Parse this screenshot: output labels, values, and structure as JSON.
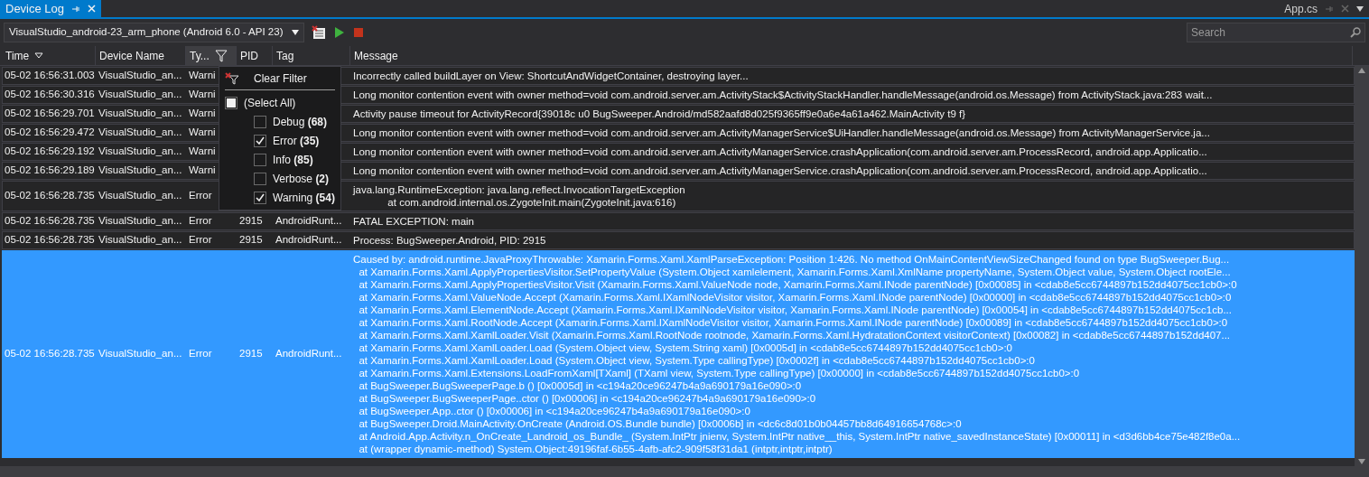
{
  "tabs": [
    {
      "label": "Device Log",
      "selected": true
    },
    {
      "label": "App.cs",
      "selected": false
    }
  ],
  "toolbar": {
    "device": "VisualStudio_android-23_arm_phone (Android 6.0 - API 23)",
    "search": {
      "placeholder": "Search"
    }
  },
  "table": {
    "columns": [
      {
        "label": "Time",
        "sorted": true
      },
      {
        "label": "Device Name",
        "sorted": false
      },
      {
        "label": "Ty...",
        "sorted": false,
        "filtered": true
      },
      {
        "label": "PID",
        "sorted": false
      },
      {
        "label": "Tag",
        "sorted": false
      },
      {
        "label": "Message",
        "sorted": false
      }
    ],
    "rows": [
      {
        "time": "05-02 16:56:31.003",
        "device": "VisualStudio_an...",
        "type": "Warni",
        "pid": "",
        "tag": "",
        "message": [
          "Incorrectly called buildLayer on View: ShortcutAndWidgetContainer, destroying layer..."
        ],
        "selected": false
      },
      {
        "time": "05-02 16:56:30.316",
        "device": "VisualStudio_an...",
        "type": "Warni",
        "pid": "",
        "tag": "",
        "message": [
          "Long monitor contention event with owner method=void com.android.server.am.ActivityStack$ActivityStackHandler.handleMessage(android.os.Message) from ActivityStack.java:283 wait..."
        ],
        "selected": false
      },
      {
        "time": "05-02 16:56:29.701",
        "device": "VisualStudio_an...",
        "type": "Warni",
        "pid": "",
        "tag": "",
        "message": [
          "Activity pause timeout for ActivityRecord{39018c u0 BugSweeper.Android/md582aafd8d025f9365ff9e0a6e4a61a462.MainActivity t9 f}"
        ],
        "selected": false
      },
      {
        "time": "05-02 16:56:29.472",
        "device": "VisualStudio_an...",
        "type": "Warni",
        "pid": "",
        "tag": "",
        "message": [
          "Long monitor contention event with owner method=void com.android.server.am.ActivityManagerService$UiHandler.handleMessage(android.os.Message) from ActivityManagerService.ja..."
        ],
        "selected": false
      },
      {
        "time": "05-02 16:56:29.192",
        "device": "VisualStudio_an...",
        "type": "Warni",
        "pid": "",
        "tag": "",
        "message": [
          "Long monitor contention event with owner method=void com.android.server.am.ActivityManagerService.crashApplication(com.android.server.am.ProcessRecord, android.app.Applicatio..."
        ],
        "selected": false
      },
      {
        "time": "05-02 16:56:29.189",
        "device": "VisualStudio_an...",
        "type": "Warni",
        "pid": "",
        "tag": "",
        "message": [
          "Long monitor contention event with owner method=void com.android.server.am.ActivityManagerService.crashApplication(com.android.server.am.ProcessRecord, android.app.Applicatio..."
        ],
        "selected": false
      },
      {
        "time": "05-02 16:56:28.735",
        "device": "VisualStudio_an...",
        "type": "Error",
        "pid": "",
        "tag": "",
        "message": [
          "java.lang.RuntimeException: java.lang.reflect.InvocationTargetException",
          "            at com.android.internal.os.ZygoteInit.main(ZygoteInit.java:616)"
        ],
        "selected": false
      },
      {
        "time": "05-02 16:56:28.735",
        "device": "VisualStudio_an...",
        "type": "Error",
        "pid": "2915",
        "tag": "AndroidRunt...",
        "message": [
          "FATAL EXCEPTION: main"
        ],
        "selected": false
      },
      {
        "time": "05-02 16:56:28.735",
        "device": "VisualStudio_an...",
        "type": "Error",
        "pid": "2915",
        "tag": "AndroidRunt...",
        "message": [
          "Process: BugSweeper.Android, PID: 2915"
        ],
        "selected": false
      },
      {
        "time": "05-02 16:56:28.735",
        "device": "VisualStudio_an...",
        "type": "Error",
        "pid": "2915",
        "tag": "AndroidRunt...",
        "message": [
          "Caused by: android.runtime.JavaProxyThrowable: Xamarin.Forms.Xaml.XamlParseException: Position 1:426. No method OnMainContentViewSizeChanged found on type BugSweeper.Bug...",
          "  at Xamarin.Forms.Xaml.ApplyPropertiesVisitor.SetPropertyValue (System.Object xamlelement, Xamarin.Forms.Xaml.XmlName propertyName, System.Object value, System.Object rootEle...",
          "  at Xamarin.Forms.Xaml.ApplyPropertiesVisitor.Visit (Xamarin.Forms.Xaml.ValueNode node, Xamarin.Forms.Xaml.INode parentNode) [0x00085] in <cdab8e5cc6744897b152dd4075cc1cb0>:0",
          "  at Xamarin.Forms.Xaml.ValueNode.Accept (Xamarin.Forms.Xaml.IXamlNodeVisitor visitor, Xamarin.Forms.Xaml.INode parentNode) [0x00000] in <cdab8e5cc6744897b152dd4075cc1cb0>:0",
          "  at Xamarin.Forms.Xaml.ElementNode.Accept (Xamarin.Forms.Xaml.IXamlNodeVisitor visitor, Xamarin.Forms.Xaml.INode parentNode) [0x00054] in <cdab8e5cc6744897b152dd4075cc1cb...",
          "  at Xamarin.Forms.Xaml.RootNode.Accept (Xamarin.Forms.Xaml.IXamlNodeVisitor visitor, Xamarin.Forms.Xaml.INode parentNode) [0x00089] in <cdab8e5cc6744897b152dd4075cc1cb0>:0",
          "  at Xamarin.Forms.Xaml.XamlLoader.Visit (Xamarin.Forms.Xaml.RootNode rootnode, Xamarin.Forms.Xaml.HydratationContext visitorContext) [0x00082] in <cdab8e5cc6744897b152dd407...",
          "  at Xamarin.Forms.Xaml.XamlLoader.Load (System.Object view, System.String xaml) [0x0005d] in <cdab8e5cc6744897b152dd4075cc1cb0>:0",
          "  at Xamarin.Forms.Xaml.XamlLoader.Load (System.Object view, System.Type callingType) [0x0002f] in <cdab8e5cc6744897b152dd4075cc1cb0>:0",
          "  at Xamarin.Forms.Xaml.Extensions.LoadFromXaml[TXaml] (TXaml view, System.Type callingType) [0x00000] in <cdab8e5cc6744897b152dd4075cc1cb0>:0",
          "  at BugSweeper.BugSweeperPage.b () [0x0005d] in <c194a20ce96247b4a9a690179a16e090>:0",
          "  at BugSweeper.BugSweeperPage..ctor () [0x00006] in <c194a20ce96247b4a9a690179a16e090>:0",
          "  at BugSweeper.App..ctor () [0x00006] in <c194a20ce96247b4a9a690179a16e090>:0",
          "  at BugSweeper.Droid.MainActivity.OnCreate (Android.OS.Bundle bundle) [0x0006b] in <dc6c8d01b0b04457bb8d64916654768c>:0",
          "  at Android.App.Activity.n_OnCreate_Landroid_os_Bundle_ (System.IntPtr jnienv, System.IntPtr native__this, System.IntPtr native_savedInstanceState) [0x00011] in <d3d6bb4ce75e482f8e0a...",
          "  at (wrapper dynamic-method) System.Object:49196faf-6b55-4afb-afc2-909f58f31da1 (intptr,intptr,intptr)"
        ],
        "selected": true
      }
    ]
  },
  "filter_menu": {
    "clear": "Clear Filter",
    "items": [
      {
        "label": "Debug **(68)**",
        "checked": false
      },
      {
        "label": "Error **(35)**",
        "checked": true
      },
      {
        "label": "Info **(85)**",
        "checked": false
      },
      {
        "label": "Verbose **(2)**",
        "checked": false
      },
      {
        "label": "Warning **(54)**",
        "checked": true
      }
    ],
    "select_all": {
      "label": "(Select All)",
      "indeterminate": true
    }
  }
}
